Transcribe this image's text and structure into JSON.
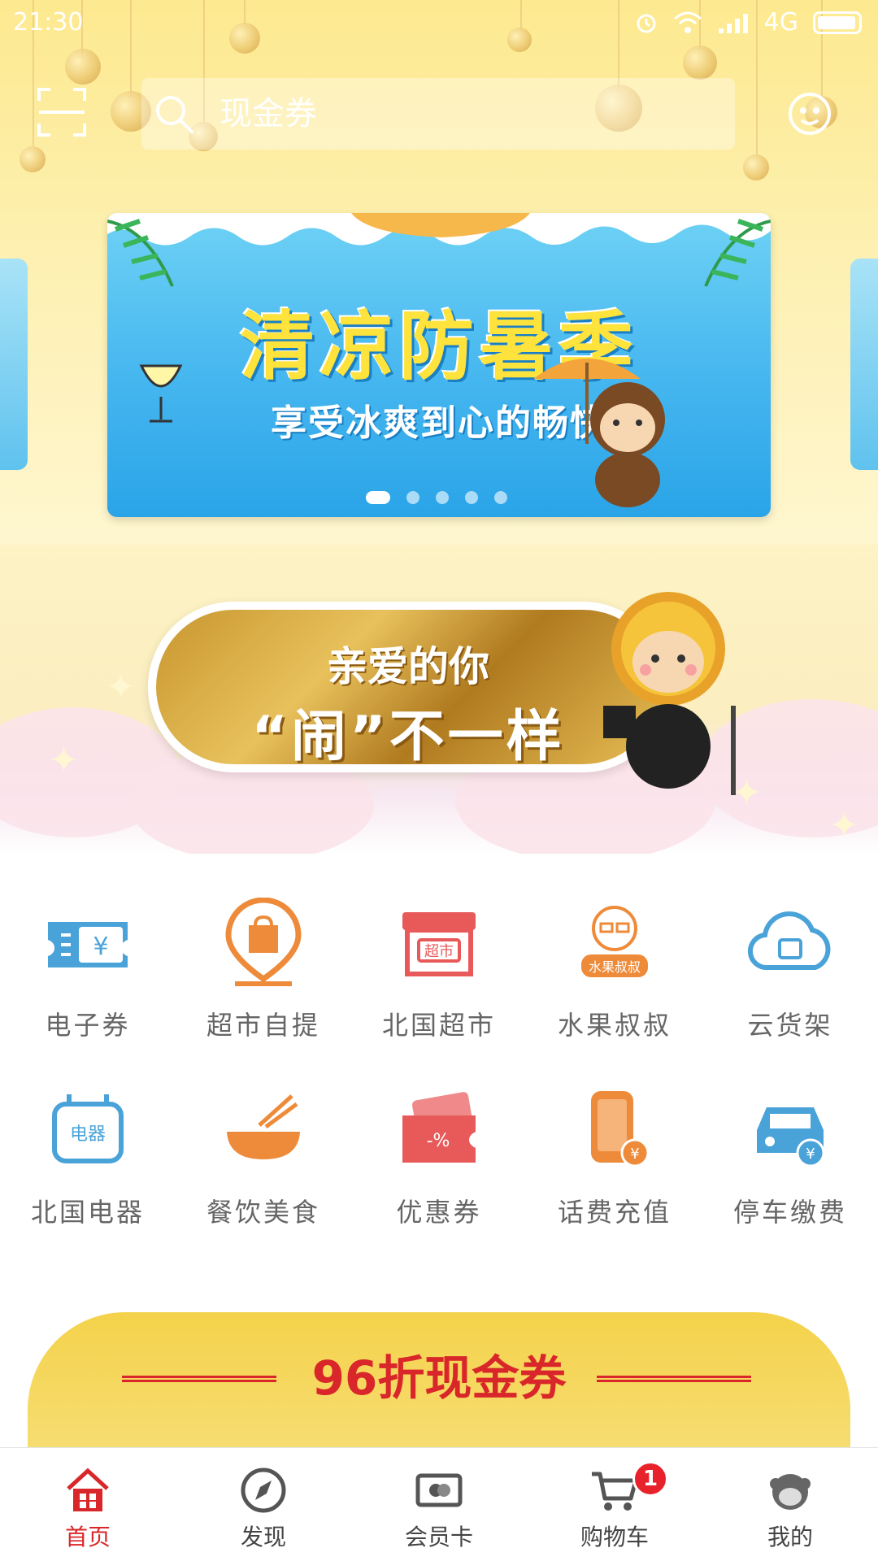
{
  "status_bar": {
    "time": "21:30",
    "network": "4G"
  },
  "header": {
    "search_placeholder": "现金券"
  },
  "carousel": {
    "title": "清凉防暑季",
    "subtitle": "享受冰爽到心的畅快",
    "page_count": 5,
    "active_index": 0
  },
  "promo": {
    "line1": "亲爱的你",
    "line2": "“闹”不一样"
  },
  "services": [
    {
      "label": "电子券",
      "icon": "e-voucher-icon"
    },
    {
      "label": "超市自提",
      "icon": "store-pickup-icon"
    },
    {
      "label": "北国超市",
      "icon": "supermarket-icon"
    },
    {
      "label": "水果叔叔",
      "icon": "fruit-uncle-icon"
    },
    {
      "label": "云货架",
      "icon": "cloud-shelf-icon"
    },
    {
      "label": "北国电器",
      "icon": "appliances-icon"
    },
    {
      "label": "餐饮美食",
      "icon": "food-bowl-icon"
    },
    {
      "label": "优惠券",
      "icon": "coupon-icon"
    },
    {
      "label": "话费充值",
      "icon": "phone-recharge-icon"
    },
    {
      "label": "停车缴费",
      "icon": "parking-payment-icon"
    }
  ],
  "voucher_banner": {
    "title": "96折现金券"
  },
  "tabbar": {
    "items": [
      {
        "label": "首页",
        "icon": "home-icon",
        "active": true
      },
      {
        "label": "发现",
        "icon": "compass-icon",
        "active": false
      },
      {
        "label": "会员卡",
        "icon": "member-card-icon",
        "active": false
      },
      {
        "label": "购物车",
        "icon": "cart-icon",
        "active": false,
        "badge": "1"
      },
      {
        "label": "我的",
        "icon": "profile-icon",
        "active": false
      }
    ]
  },
  "colors": {
    "accent_red": "#d9262a",
    "icon_blue": "#4aa3d8",
    "icon_orange": "#ee8b3a",
    "icon_red": "#e85a5a"
  }
}
